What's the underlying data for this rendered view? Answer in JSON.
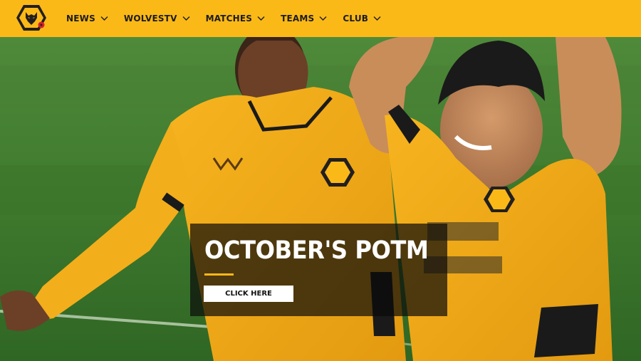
{
  "brand": {
    "logo_icon": "wolves-crest-icon",
    "accent": "#fbb918"
  },
  "nav": {
    "items": [
      {
        "label": "NEWS"
      },
      {
        "label": "WOLVESTV"
      },
      {
        "label": "MATCHES"
      },
      {
        "label": "TEAMS"
      },
      {
        "label": "CLUB"
      }
    ]
  },
  "hero": {
    "headline": "OCTOBER'S POTM",
    "cta_label": "CLICK HERE",
    "overlay_color": "#0a0a0a"
  }
}
